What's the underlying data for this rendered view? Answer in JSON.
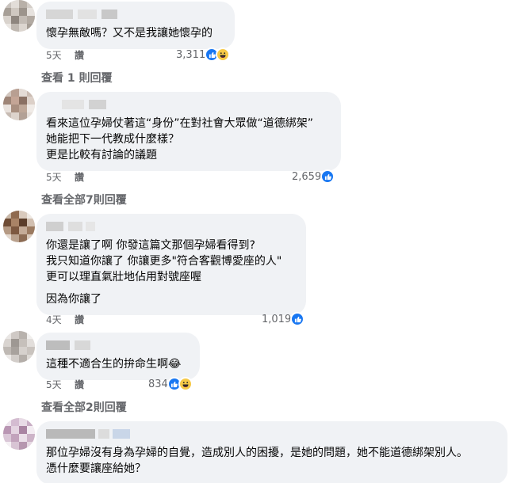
{
  "comments": [
    {
      "body": [
        "懷孕無敵嗎？又不是我讓她懷孕的"
      ],
      "time": "5天",
      "like": "讚",
      "reaction_count": "3,311",
      "reactions": [
        "like-icon",
        "haha-icon"
      ],
      "replies": "查看 1 則回覆"
    },
    {
      "body": [
        "看來這位孕婦仗著這“身份”在對社會大眾做“道德綁架”",
        "她能把下一代教成什麼樣？",
        "更是比較有討論的議題"
      ],
      "time": "5天",
      "like": "讚",
      "reaction_count": "2,659",
      "reactions": [
        "like-icon"
      ],
      "replies": "查看全部7則回覆"
    },
    {
      "body": [
        "你還是讓了啊 你發這篇文那個孕婦看得到?",
        "我只知道你讓了 你讓更多\"符合客觀博愛座的人\"",
        "更可以理直氣壯地佔用對號座喔",
        "因為你讓了"
      ],
      "time": "4天",
      "like": "讚",
      "reaction_count": "1,019",
      "reactions": [
        "like-icon"
      ]
    },
    {
      "body": [
        "這種不適合生的拚命生啊😂"
      ],
      "time": "5天",
      "like": "讚",
      "reaction_count": "834",
      "reactions": [
        "like-icon",
        "haha-icon"
      ],
      "replies": "查看全部2則回覆"
    },
    {
      "body": [
        "那位孕婦沒有身為孕婦的自覺，造成別人的困擾，是她的問題，她不能道德綁架別人。",
        "憑什麼要讓座給她？"
      ]
    }
  ],
  "colors": {
    "bubble": "#f0f2f5",
    "meta_text": "#65676b",
    "like_blue": "#1877f2",
    "haha_yellow": "#f7c947"
  }
}
